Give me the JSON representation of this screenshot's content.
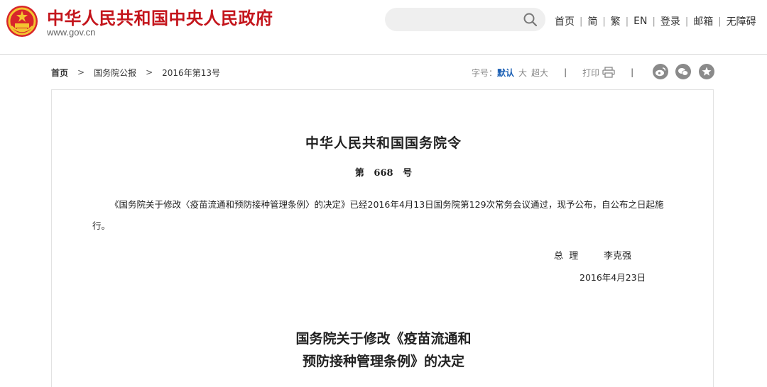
{
  "header": {
    "site_title": "中华人民共和国中央人民政府",
    "site_url": "www.gov.cn",
    "search": {
      "value": "",
      "placeholder": ""
    },
    "top_links": [
      "首页",
      "简",
      "繁",
      "EN",
      "登录",
      "邮箱",
      "无障碍"
    ]
  },
  "breadcrumb": {
    "home": "首页",
    "section": "国务院公报",
    "issue": "2016年第13号"
  },
  "tools": {
    "font_size_label": "字号：",
    "font_default": "默认",
    "font_large": "大",
    "font_xlarge": "超大",
    "print_label": "打印"
  },
  "share": {
    "icons": [
      "weibo-icon",
      "wechat-icon",
      "favorite-star-icon"
    ]
  },
  "document": {
    "title": "中华人民共和国国务院令",
    "order_number": "第   668   号",
    "paragraph": "《国务院关于修改〈疫苗流通和预防接种管理条例〉的决定》已经2016年4月13日国务院第129次常务会议通过，现予公布，自公布之日起施行。",
    "signatory_title": "总  理",
    "signatory_name": "李克强",
    "date": "2016年4月23日",
    "sub_title_line1": "国务院关于修改《疫苗流通和",
    "sub_title_line2": "预防接种管理条例》的决定"
  },
  "colors": {
    "brand_red": "#c4151c",
    "accent_blue": "#1a5fb4",
    "icon_gray": "#8a8a8a"
  }
}
